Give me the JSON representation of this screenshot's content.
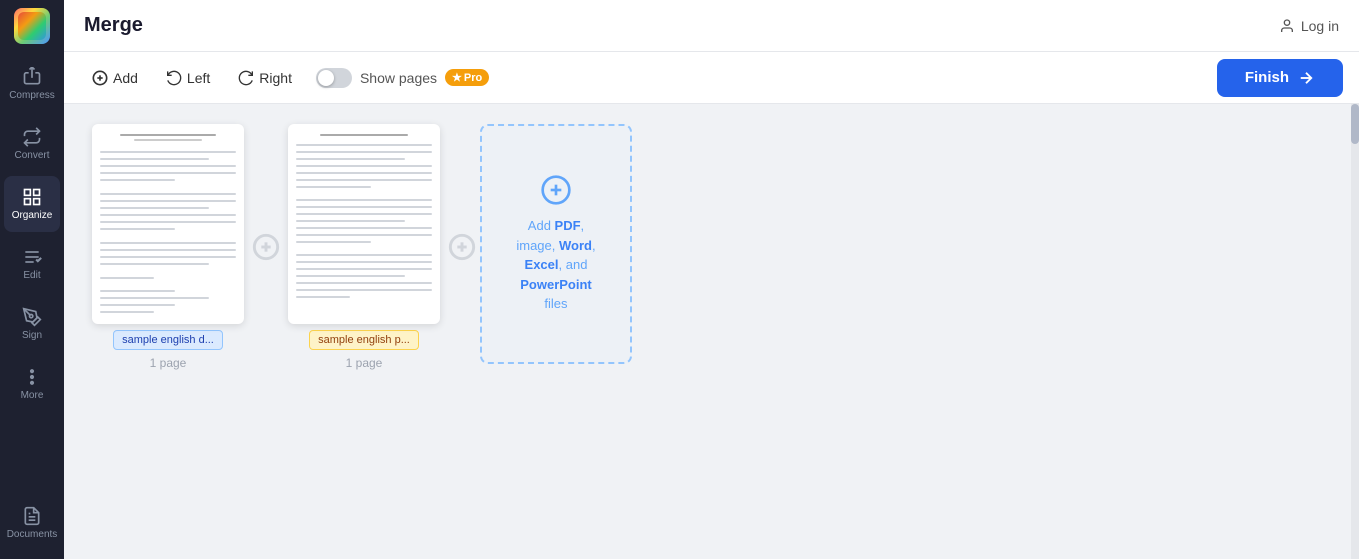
{
  "app": {
    "title": "Merge",
    "logo_alt": "App Logo"
  },
  "header": {
    "login_label": "Log in"
  },
  "sidebar": {
    "items": [
      {
        "id": "compress",
        "label": "Compress",
        "icon": "compress-icon"
      },
      {
        "id": "convert",
        "label": "Convert",
        "icon": "convert-icon"
      },
      {
        "id": "organize",
        "label": "Organize",
        "icon": "organize-icon",
        "active": true
      },
      {
        "id": "edit",
        "label": "Edit",
        "icon": "edit-icon"
      },
      {
        "id": "sign",
        "label": "Sign",
        "icon": "sign-icon"
      },
      {
        "id": "more",
        "label": "More",
        "icon": "more-icon"
      },
      {
        "id": "documents",
        "label": "Documents",
        "icon": "documents-icon"
      }
    ]
  },
  "toolbar": {
    "add_label": "Add",
    "left_label": "Left",
    "right_label": "Right",
    "show_pages_label": "Show pages",
    "pro_badge": "Pro",
    "finish_label": "Finish"
  },
  "documents": [
    {
      "id": "doc1",
      "name": "sample english d...",
      "pages": "1 page",
      "badge_color": "blue"
    },
    {
      "id": "doc2",
      "name": "sample english p...",
      "pages": "1 page",
      "badge_color": "yellow"
    }
  ],
  "dropzone": {
    "line1": "Add ",
    "formats": [
      "PDF",
      "image",
      "Word",
      "Excel",
      "PowerPoint"
    ],
    "line_end": " files",
    "text_parts": {
      "prefix": "Add ",
      "pdf": "PDF",
      "comma1": ", ",
      "image": "image",
      "comma2": ", ",
      "word": "Word",
      "comma3": ", ",
      "excel": "Excel",
      "and": ", and ",
      "powerpoint": "PowerPoint",
      "suffix": " files"
    }
  }
}
